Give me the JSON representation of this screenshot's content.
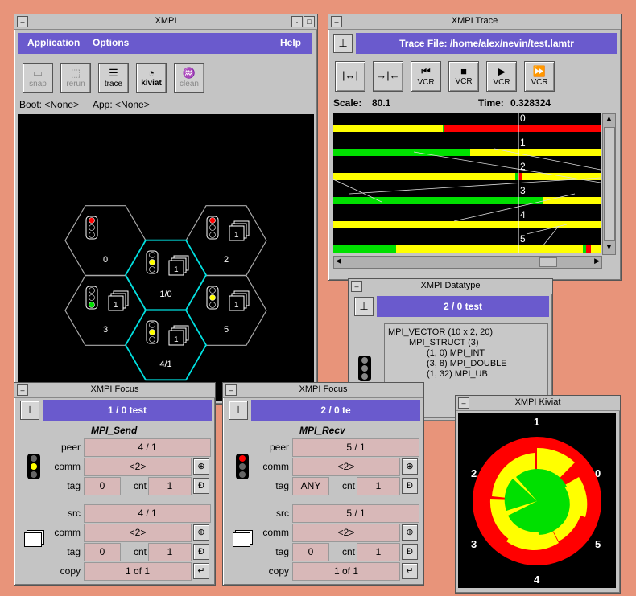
{
  "main": {
    "title": "XMPI",
    "menu": [
      "Application",
      "Options",
      "Help"
    ],
    "tools": [
      {
        "label": "snap",
        "icon": "snapshot-icon",
        "enabled": false
      },
      {
        "label": "rerun",
        "icon": "rerun-icon",
        "enabled": false
      },
      {
        "label": "trace",
        "icon": "trace-icon",
        "enabled": true
      },
      {
        "label": "kiviat",
        "icon": "kiviat-icon",
        "enabled": true
      },
      {
        "label": "clean",
        "icon": "clean-icon",
        "enabled": false
      }
    ],
    "boot": "Boot: <None>",
    "app": "App: <None>",
    "nodes": [
      {
        "label": "0",
        "light": "red"
      },
      {
        "label": "2",
        "light": "red"
      },
      {
        "label": "1/0",
        "light": "yellow"
      },
      {
        "label": "3",
        "light": "green"
      },
      {
        "label": "5",
        "light": "yellow"
      },
      {
        "label": "4/1",
        "light": "yellow"
      }
    ]
  },
  "trace": {
    "title": "XMPI Trace",
    "file": "Trace File: /home/alex/nevin/test.lamtr",
    "scale_label": "Scale:",
    "scale": "80.1",
    "time_label": "Time:",
    "time": "0.328324",
    "vcr": [
      "VCR",
      "VCR",
      "VCR",
      "VCR"
    ],
    "rank_labels": [
      "0",
      "1",
      "2",
      "3",
      "4",
      "5"
    ],
    "colors": {
      "run": "#00e000",
      "sys": "#ffff00",
      "block": "#ff0000"
    }
  },
  "datatype": {
    "title": "XMPI Datatype",
    "header": "2 / 0   test",
    "lines": [
      "MPI_VECTOR (10 x 2, 20)",
      "MPI_STRUCT (3)",
      "(1, 0)  MPI_INT",
      "(3, 8)  MPI_DOUBLE",
      "(1, 32) MPI_UB"
    ]
  },
  "kiviat": {
    "title": "XMPI Kiviat",
    "labels": [
      "1",
      "0",
      "5",
      "4",
      "3",
      "2"
    ]
  },
  "focus1": {
    "title": "XMPI Focus",
    "header": "1 / 0   test",
    "func": "MPI_Send",
    "peer_label": "peer",
    "peer": "4 / 1",
    "comm_label": "comm",
    "comm": "<2>",
    "tag_label": "tag",
    "tag": "0",
    "cnt_label": "cnt",
    "cnt": "1",
    "src_label": "src",
    "src": "4 / 1",
    "comm2": "<2>",
    "tag2": "0",
    "cnt2": "1",
    "copy_label": "copy",
    "copy": "1   of 1"
  },
  "focus2": {
    "title": "XMPI Focus",
    "header": "2 / 0   te",
    "func": "MPI_Recv",
    "peer_label": "peer",
    "peer": "5 / 1",
    "comm_label": "comm",
    "comm": "<2>",
    "tag_label": "tag",
    "tag": "ANY",
    "cnt_label": "cnt",
    "cnt": "1",
    "src_label": "src",
    "src": "5 / 1",
    "comm2": "<2>",
    "tag2": "0",
    "cnt2": "1",
    "copy_label": "copy",
    "copy": "1   of 1"
  }
}
